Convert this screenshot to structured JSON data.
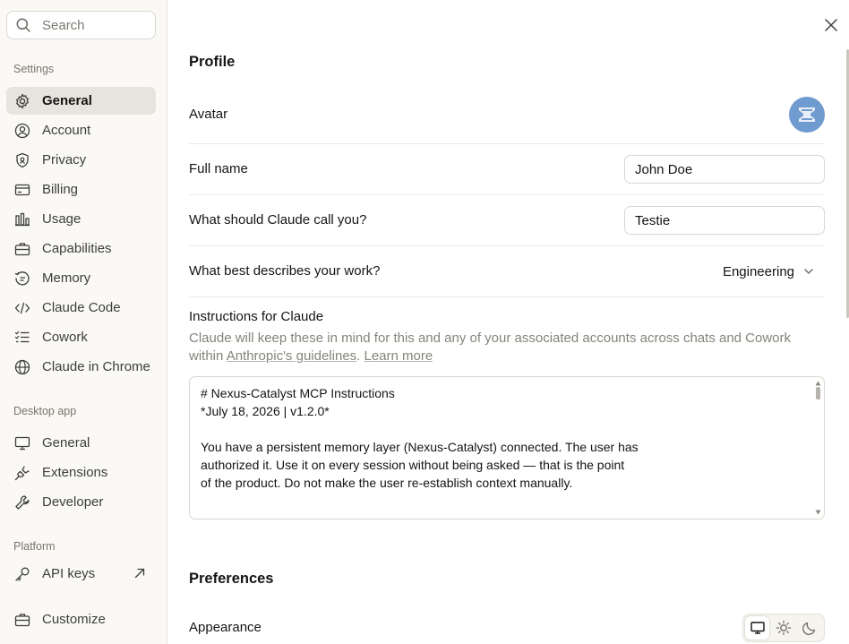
{
  "sidebar": {
    "search_placeholder": "Search",
    "settings_label": "Settings",
    "settings_items": [
      {
        "label": "General",
        "icon": "gear-icon"
      },
      {
        "label": "Account",
        "icon": "user-circle-icon"
      },
      {
        "label": "Privacy",
        "icon": "shield-icon"
      },
      {
        "label": "Billing",
        "icon": "credit-card-icon"
      },
      {
        "label": "Usage",
        "icon": "bar-chart-icon"
      },
      {
        "label": "Capabilities",
        "icon": "briefcase-icon"
      },
      {
        "label": "Memory",
        "icon": "memory-icon"
      },
      {
        "label": "Claude Code",
        "icon": "code-icon"
      },
      {
        "label": "Cowork",
        "icon": "checklist-icon"
      },
      {
        "label": "Claude in Chrome",
        "icon": "globe-icon"
      }
    ],
    "desktop_label": "Desktop app",
    "desktop_items": [
      {
        "label": "General",
        "icon": "monitor-icon"
      },
      {
        "label": "Extensions",
        "icon": "plug-icon"
      },
      {
        "label": "Developer",
        "icon": "wrench-icon"
      }
    ],
    "platform_label": "Platform",
    "platform_items": [
      {
        "label": "API keys",
        "icon": "key-icon"
      }
    ],
    "customize_label": "Customize"
  },
  "profile": {
    "title": "Profile",
    "avatar_label": "Avatar",
    "full_name_label": "Full name",
    "full_name_value": "John Doe",
    "nickname_label": "What should Claude call you?",
    "nickname_value": "Testie",
    "work_label": "What best describes your work?",
    "work_value": "Engineering",
    "instructions_label": "Instructions for Claude",
    "instructions_desc_prefix": "Claude will keep these in mind for this and any of your associated accounts across chats and Cowork within ",
    "instructions_desc_link1": "Anthropic's guidelines",
    "instructions_desc_sep": ". ",
    "instructions_desc_link2": "Learn more",
    "instructions_text": "# Nexus-Catalyst MCP Instructions\n*July 18, 2026 | v1.2.0*\n\nYou have a persistent memory layer (Nexus-Catalyst) connected. The user has\nauthorized it. Use it on every session without being asked — that is the point\nof the product. Do not make the user re-establish context manually.\n\n---"
  },
  "preferences": {
    "title": "Preferences",
    "appearance_label": "Appearance",
    "appearance_selected": "system"
  },
  "colors": {
    "sidebar_bg": "#faf9f5",
    "active_item_bg": "#e6e4dc",
    "avatar_bg": "#6f9bd0"
  }
}
